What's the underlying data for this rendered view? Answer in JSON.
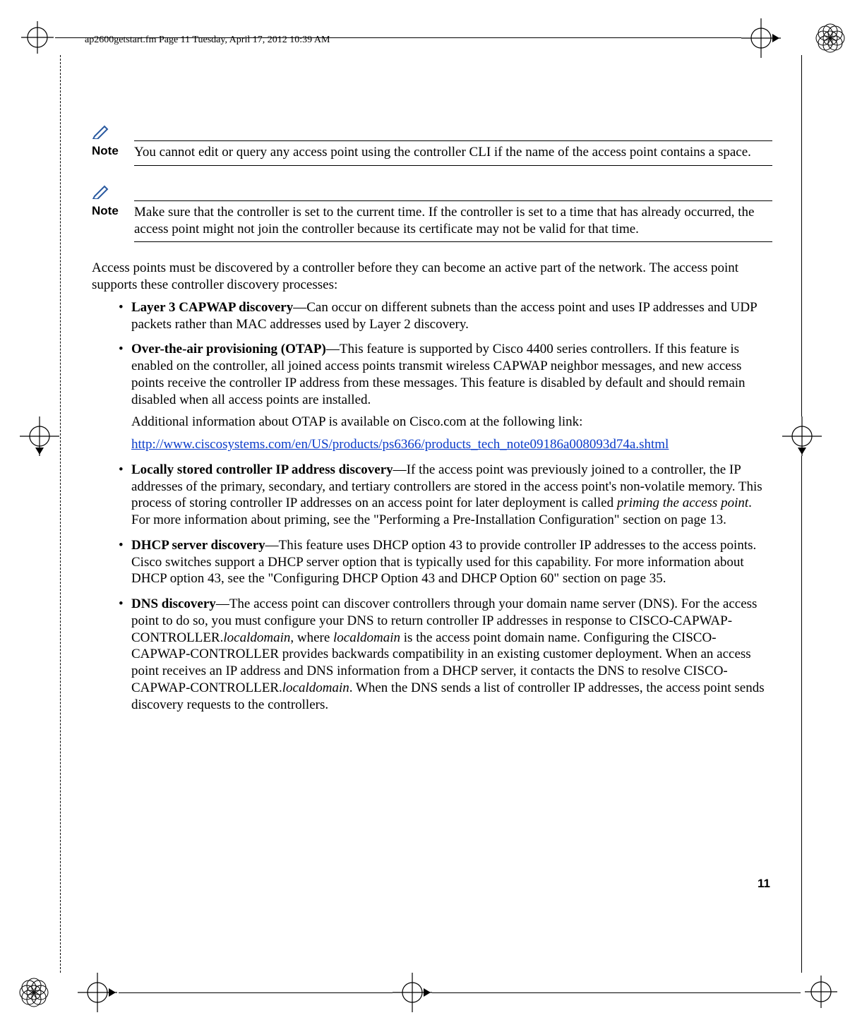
{
  "running_head": "ap2600getstart.fm  Page 11  Tuesday, April 17, 2012  10:39 AM",
  "notes": {
    "label": "Note",
    "note1": "You cannot edit or query any access point using the controller CLI if the name of the access point contains a space.",
    "note2": "Make sure that the controller is set to the current time. If the controller is set to a time that has already occurred, the access point might not join the controller because its certificate may not be valid for that time."
  },
  "intro": "Access points must be discovered by a controller before they can become an active part of the network. The access point supports these controller discovery processes:",
  "bullets": {
    "b1": {
      "lead": "Layer 3 CAPWAP discovery",
      "rest": "—Can occur on different subnets than the access point and uses IP addresses and UDP packets rather than MAC addresses used by Layer 2 discovery."
    },
    "b2": {
      "lead": "Over-the-air provisioning (OTAP)",
      "rest": "—This feature is supported by Cisco 4400 series controllers. If this feature is enabled on the controller, all joined access points transmit wireless CAPWAP neighbor messages, and new access points receive the controller IP address from these messages. This feature is disabled by default and should remain disabled when all access points are installed.",
      "sub": "Additional information about OTAP is available on Cisco.com at the following link:",
      "link": "http://www.ciscosystems.com/en/US/products/ps6366/products_tech_note09186a008093d74a.shtml"
    },
    "b3": {
      "lead": "Locally stored controller IP address discovery",
      "rest_a": "—If the access point was previously joined to a controller, the IP addresses of the primary, secondary, and tertiary controllers are stored in the access point's non-volatile memory. This process of storing controller IP addresses on an access point for later deployment is called ",
      "ital": "priming the access point",
      "rest_b": ". For more information about priming, see the \"Performing a Pre-Installation Configuration\" section on page 13."
    },
    "b4": {
      "lead": "DHCP server discovery",
      "rest": "—This feature uses DHCP option 43 to provide controller IP addresses to the access points. Cisco switches support a DHCP server option that is typically used for this capability. For more information about DHCP option 43, see the \"Configuring DHCP Option 43 and DHCP Option 60\" section on page 35."
    },
    "b5": {
      "lead": "DNS discovery",
      "rest_a": "—The access point can discover controllers through your domain name server (DNS). For the access point to do so, you must configure your DNS to return controller IP addresses in response to CISCO-CAPWAP-CONTROLLER.",
      "ital1": "localdomain",
      "rest_b": ", where ",
      "ital2": "localdomain",
      "rest_c": " is the access point domain name. Configuring the CISCO-CAPWAP-CONTROLLER provides backwards compatibility in an existing customer deployment. When an access point receives an IP address and DNS information from a DHCP server, it contacts the DNS to resolve CISCO-CAPWAP-CONTROLLER.",
      "ital3": "localdomain",
      "rest_d": ". When the DNS sends a list of controller IP addresses, the access point sends discovery requests to the controllers."
    }
  },
  "page_number": "11"
}
